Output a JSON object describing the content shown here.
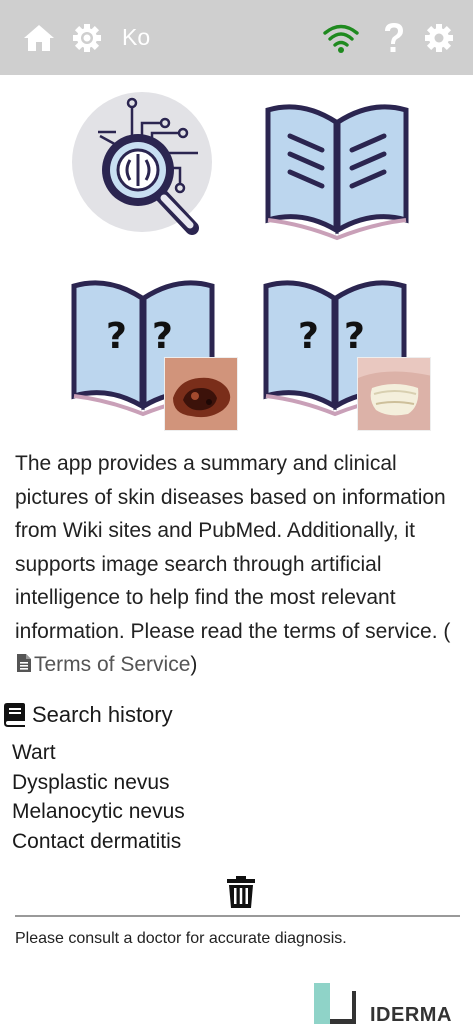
{
  "topbar": {
    "home_icon": "home-icon",
    "settings_icon": "gear-icon",
    "language": "Ko",
    "wifi_icon": "wifi-icon",
    "help_icon": "question-icon",
    "settings2_icon": "cog-icon",
    "wifi_color": "#1f8a1f"
  },
  "tiles": [
    {
      "icon": "ai-image-search-icon"
    },
    {
      "icon": "open-book-icon"
    },
    {
      "icon": "book-question-melanoma-icon"
    },
    {
      "icon": "book-question-nail-icon"
    }
  ],
  "description": {
    "text": "The app provides a summary and clinical pictures of skin diseases based on information from Wiki sites and PubMed. Additionally, it supports image search through artificial intelligence to help find the most relevant information. Please read the terms of service. (",
    "link_label": "Terms of Service",
    "close_paren": ")"
  },
  "history": {
    "title": "Search history",
    "items": [
      "Wart",
      "Dysplastic nevus",
      "Melanocytic nevus",
      "Contact dermatitis"
    ]
  },
  "footer": {
    "disclaimer": "Please consult a doctor for accurate diagnosis.",
    "brand": "IDERMA"
  },
  "colors": {
    "topbar_bg": "#cfcfcf",
    "book_outline": "#2b2550",
    "book_page": "#bcd6ee",
    "brand_teal": "#8fd3c8"
  }
}
